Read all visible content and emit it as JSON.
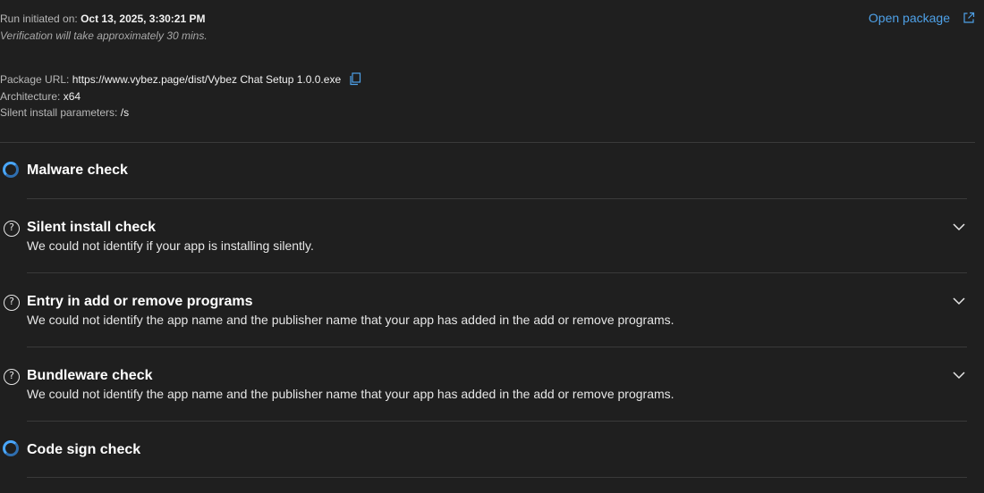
{
  "run": {
    "initiated_label": "Run initiated on: ",
    "initiated_value": "Oct 13, 2025, 3:30:21 PM",
    "verification_note": "Verification will take approximately 30 mins."
  },
  "open_package": {
    "label": "Open package",
    "icon": "external-link-icon"
  },
  "package": {
    "url_label": "Package URL: ",
    "url_value": "https://www.vybez.page/dist/Vybez Chat Setup 1.0.0.exe",
    "copy_icon": "copy-icon",
    "arch_label": "Architecture: ",
    "arch_value": "x64",
    "silent_label": "Silent install parameters: ",
    "silent_value": "/s"
  },
  "checks": [
    {
      "title": "Malware check",
      "status": "in-progress",
      "description": ""
    },
    {
      "title": "Silent install check",
      "status": "unknown",
      "description": "We could not identify if your app is installing silently."
    },
    {
      "title": "Entry in add or remove programs",
      "status": "unknown",
      "description": "We could not identify the app name and the publisher name that your app has added in the add or remove programs."
    },
    {
      "title": "Bundleware check",
      "status": "unknown",
      "description": "We could not identify the app name and the publisher name that your app has added in the add or remove programs."
    },
    {
      "title": "Code sign check",
      "status": "in-progress",
      "description": ""
    }
  ],
  "colors": {
    "background": "#1f1f1f",
    "link": "#4ea1e8",
    "spinner": "#4aa8ff",
    "divider": "#3a3a3a"
  }
}
